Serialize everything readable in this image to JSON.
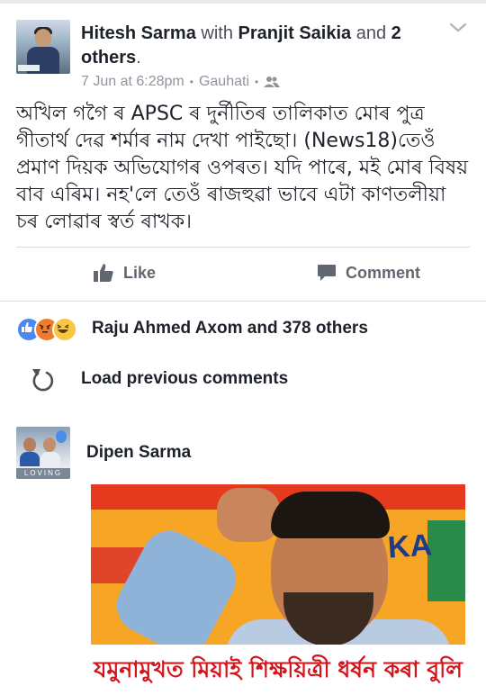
{
  "post": {
    "author": "Hitesh Sarma",
    "with_word": "with",
    "tagged": "Pranjit Saikia",
    "and_word": "and",
    "others_link": "2 others",
    "period": ".",
    "date": "7 Jun at 6:28pm",
    "location": "Gauhati",
    "privacy_icon": "friends-icon",
    "text": "অখিল গগৈ ৰ APSC ৰ দুৰ্নীতিৰ তালিকাত মোৰ পুত্ৰ গীতাৰ্থ দেৱ শৰ্মাৰ নাম দেখা পাইছো। (News18)তেওঁ প্ৰমাণ দিয়ক অভিযোগৰ ওপৰত। যদি পাৰে, মই মোৰ বিষয় বাব এৰিম। নহ'লে তেওঁ ৰাজহুৱা ভাবে এটা কাণতলীয়া চৰ লোৱাৰ স্বৰ্ত ৰাখক।"
  },
  "actions": {
    "like_label": "Like",
    "comment_label": "Comment"
  },
  "reactions": {
    "icons": [
      "like-reaction",
      "angry-reaction",
      "haha-reaction"
    ],
    "summary": "Raju Ahmed Axom and 378 others"
  },
  "comments": {
    "load_previous": "Load previous comments",
    "items": [
      {
        "author": "Dipen Sarma",
        "avatar_caption": "LOVING",
        "image_caption": "যমুনামুখত মিয়াই শিক্ষয়িত্ৰী ধৰ্ষন কৰা বুলি",
        "image_background_text": "KA"
      }
    ]
  },
  "colors": {
    "link": "#365899",
    "meta": "#90949c",
    "action": "#606770",
    "divider": "#dadde1",
    "caption_red": "#d4141b"
  }
}
